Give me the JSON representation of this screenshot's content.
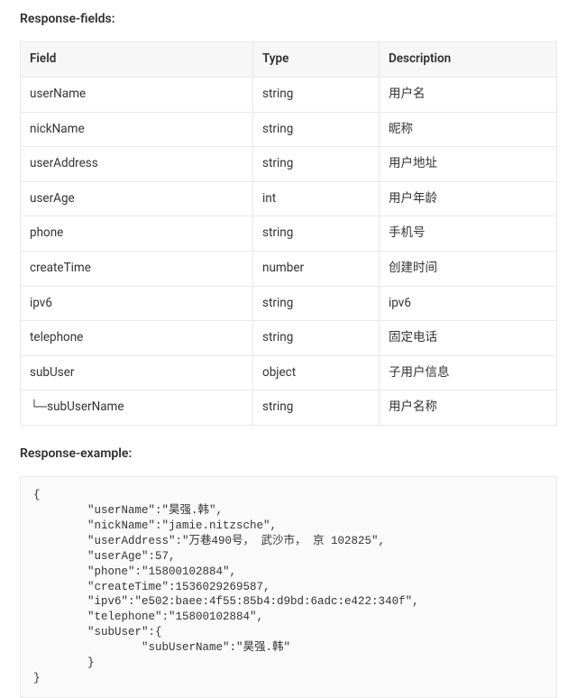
{
  "responseFields": {
    "heading": "Response-fields:",
    "columns": {
      "field": "Field",
      "type": "Type",
      "description": "Description"
    },
    "rows": [
      {
        "field": "userName",
        "type": "string",
        "description": "用户名"
      },
      {
        "field": "nickName",
        "type": "string",
        "description": "昵称"
      },
      {
        "field": "userAddress",
        "type": "string",
        "description": "用户地址"
      },
      {
        "field": "userAge",
        "type": "int",
        "description": "用户年龄"
      },
      {
        "field": "phone",
        "type": "string",
        "description": "手机号"
      },
      {
        "field": "createTime",
        "type": "number",
        "description": "创建时间"
      },
      {
        "field": "ipv6",
        "type": "string",
        "description": "ipv6"
      },
      {
        "field": "telephone",
        "type": "string",
        "description": "固定电话"
      },
      {
        "field": "subUser",
        "type": "object",
        "description": "子用户信息"
      },
      {
        "field": "└─subUserName",
        "type": "string",
        "description": "用户名称"
      }
    ]
  },
  "responseExample": {
    "heading": "Response-example:",
    "code": "{\n        \"userName\":\"昊强.韩\",\n        \"nickName\":\"jamie.nitzsche\",\n        \"userAddress\":\"万巷490号， 武沙市， 京 102825\",\n        \"userAge\":57,\n        \"phone\":\"15800102884\",\n        \"createTime\":1536029269587,\n        \"ipv6\":\"e502:baee:4f55:85b4:d9bd:6adc:e422:340f\",\n        \"telephone\":\"15800102884\",\n        \"subUser\":{\n                \"subUserName\":\"昊强.韩\"\n        }\n}"
  }
}
